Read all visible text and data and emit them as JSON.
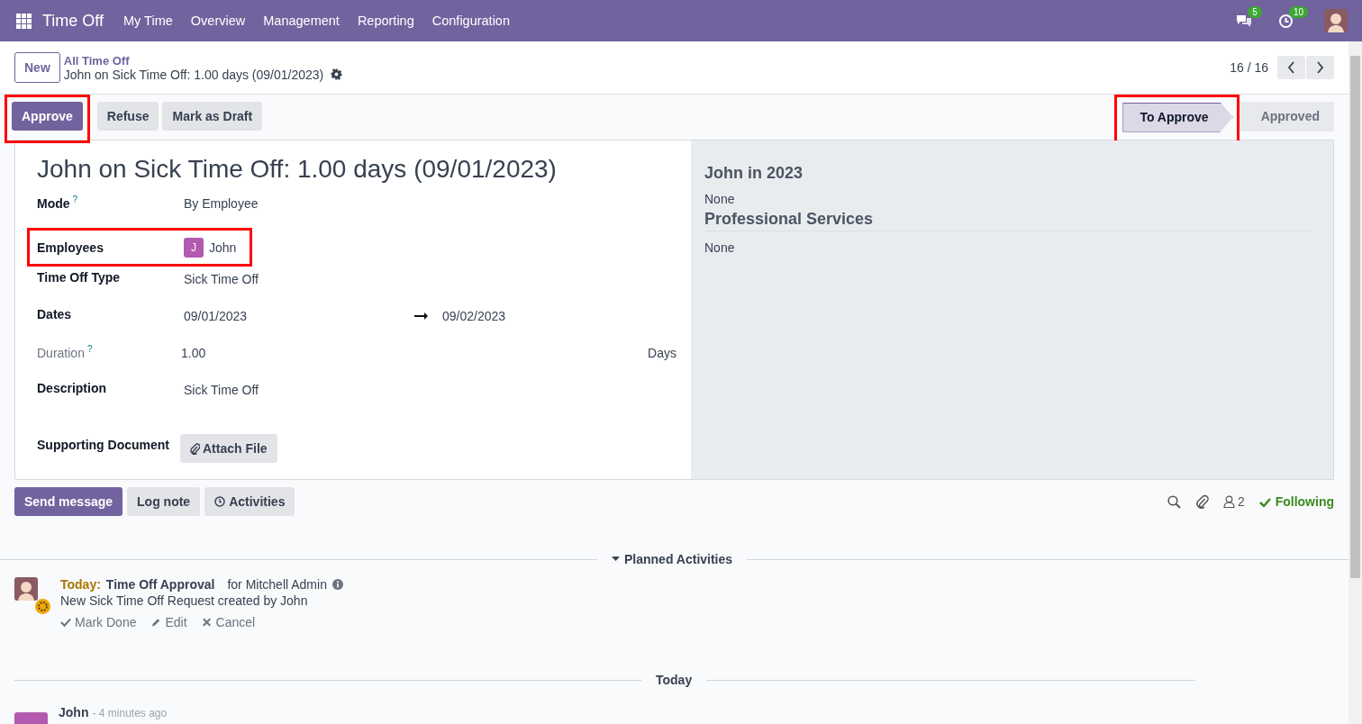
{
  "navbar": {
    "app": "Time Off",
    "menus": [
      "My Time",
      "Overview",
      "Management",
      "Reporting",
      "Configuration"
    ],
    "messages_badge": "5",
    "activities_badge": "10"
  },
  "control_panel": {
    "new_button": "New",
    "breadcrumb": "All Time Off",
    "record_title": "John on Sick Time Off: 1.00 days (09/01/2023)",
    "pager": "16 / 16"
  },
  "actions": [
    {
      "label": "Approve",
      "primary": true,
      "highlighted": true
    },
    {
      "label": "Refuse",
      "primary": false
    },
    {
      "label": "Mark as Draft",
      "primary": false
    }
  ],
  "statusbar": [
    {
      "label": "To Approve",
      "selected": true,
      "highlighted": true
    },
    {
      "label": "Approved",
      "selected": false
    }
  ],
  "form": {
    "title": "John on Sick Time Off: 1.00 days (09/01/2023)",
    "fields": [
      {
        "kind": "text",
        "label": "Mode",
        "help": "?",
        "muted": false,
        "value": "By Employee"
      },
      {
        "kind": "tag",
        "label": "Employees",
        "muted": false,
        "highlighted": true,
        "initial": "J",
        "color": "#b25aaf",
        "value": "John"
      },
      {
        "kind": "text",
        "label": "Time Off Type",
        "muted": false,
        "value": "Sick Time Off"
      },
      {
        "kind": "daterange",
        "label": "Dates",
        "muted": false,
        "value": "09/01/2023",
        "end": "09/02/2023"
      },
      {
        "kind": "duration",
        "label": "Duration",
        "help": "?",
        "muted": true,
        "value": "1.00",
        "unit": "Days"
      },
      {
        "kind": "text",
        "label": "Description",
        "muted": false,
        "value": "Sick Time Off"
      },
      {
        "kind": "button",
        "label": "Supporting Document",
        "muted": false,
        "value": "Attach File"
      }
    ],
    "side": [
      {
        "heading": "John in 2023",
        "value": "None"
      },
      {
        "heading": "Professional Services",
        "value": "None",
        "divider": true
      }
    ]
  },
  "chatter": {
    "buttons": [
      {
        "label": "Send message",
        "primary": true,
        "kind": "message"
      },
      {
        "label": "Log note",
        "primary": false,
        "kind": "note"
      },
      {
        "label": "Activities",
        "primary": false,
        "kind": "activities"
      }
    ],
    "followers": "2",
    "following": "Following",
    "planned_heading": "Planned Activities",
    "activities": [
      {
        "due": "Today:",
        "title": "Time Off Approval",
        "assignee": "for Mitchell Admin",
        "note": "New Sick Time Off Request created by John",
        "actions": [
          {
            "kind": "done",
            "label": "Mark Done"
          },
          {
            "kind": "edit",
            "label": "Edit"
          },
          {
            "kind": "cancel",
            "label": "Cancel"
          }
        ]
      }
    ],
    "date_divider": "Today",
    "messages": [
      {
        "author": "John",
        "time": "- 4 minutes ago",
        "color": "#b25aaf"
      }
    ]
  }
}
